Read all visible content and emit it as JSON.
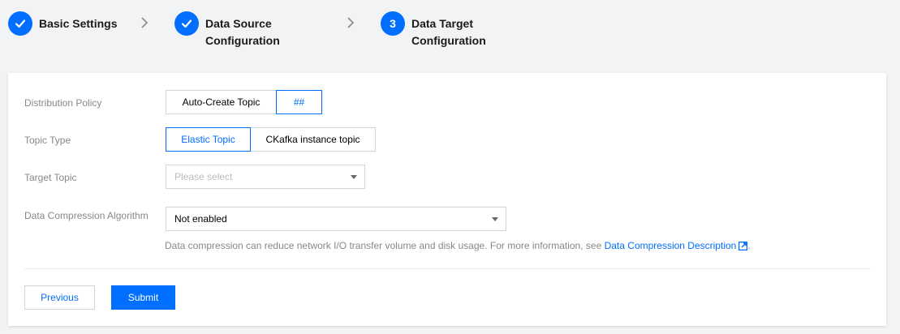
{
  "stepper": {
    "steps": [
      {
        "label": "Basic Settings",
        "state": "done",
        "icon": "check-icon"
      },
      {
        "label": "Data Source\nConfiguration",
        "state": "done",
        "icon": "check-icon"
      },
      {
        "label": "Data Target\nConfiguration",
        "state": "current",
        "number": "3"
      }
    ],
    "separator_icon": "chevron-right-icon"
  },
  "form": {
    "distribution_policy": {
      "label": "Distribution Policy",
      "options": [
        "Auto-Create Topic",
        "##"
      ],
      "selected": "##"
    },
    "topic_type": {
      "label": "Topic Type",
      "options": [
        "Elastic Topic",
        "CKafka instance topic"
      ],
      "selected": "Elastic Topic"
    },
    "target_topic": {
      "label": "Target Topic",
      "placeholder": "Please select"
    },
    "compression": {
      "label": "Data Compression Algorithm",
      "value": "Not enabled",
      "help_text": "Data compression can reduce network I/O transfer volume and disk usage. For more information, see ",
      "help_link": "Data Compression Description",
      "help_suffix": "."
    }
  },
  "actions": {
    "previous_label": "Previous",
    "submit_label": "Submit"
  },
  "colors": {
    "accent": "#006eff",
    "background": "#f2f3f5"
  }
}
